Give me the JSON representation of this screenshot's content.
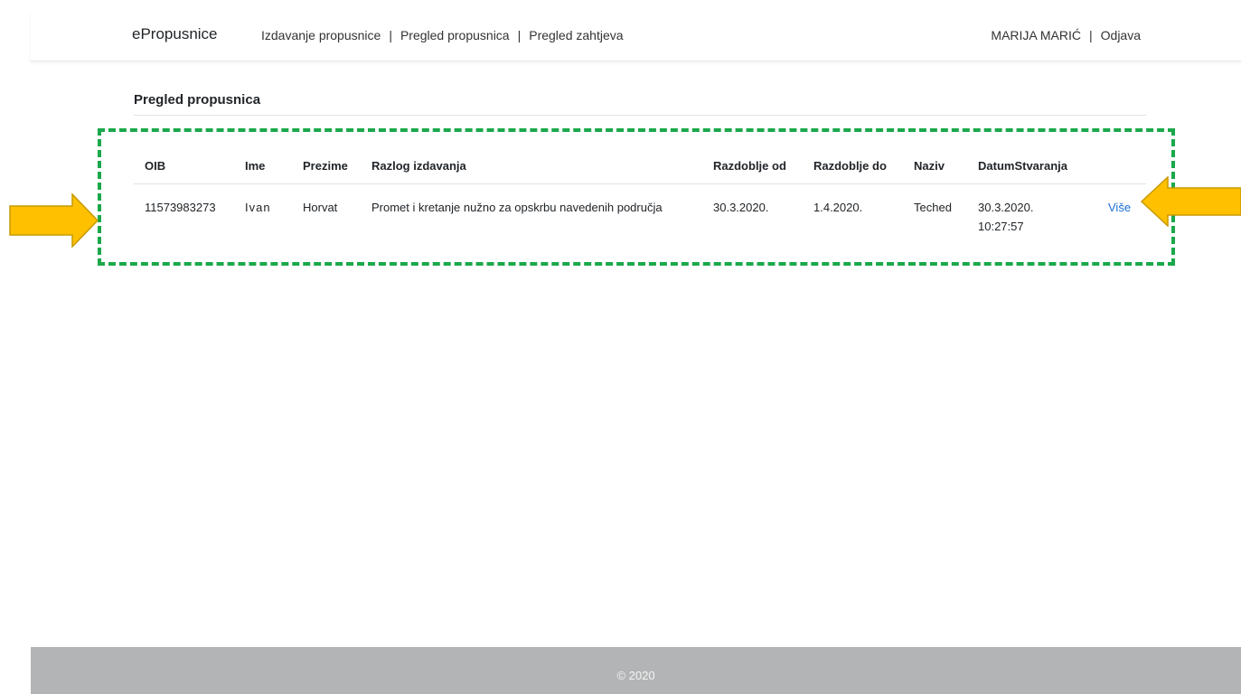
{
  "navbar": {
    "brand": "ePropusnice",
    "links": [
      "Izdavanje propusnice",
      "Pregled propusnica",
      "Pregled zahtjeva"
    ],
    "separator": "|",
    "user_name": "MARIJA MARIĆ",
    "logout": "Odjava"
  },
  "page": {
    "title": "Pregled propusnica"
  },
  "table": {
    "headers": [
      "OIB",
      "Ime",
      "Prezime",
      "Razlog izdavanja",
      "Razdoblje od",
      "Razdoblje do",
      "Naziv",
      "DatumStvaranja",
      ""
    ],
    "rows": [
      {
        "oib": "11573983273",
        "ime": "Ivan",
        "prezime": "Horvat",
        "razlog": "Promet i kretanje nužno za opskrbu navedenih područja",
        "od": "30.3.2020.",
        "do": "1.4.2020.",
        "naziv": "Teched",
        "datum": "30.3.2020. 10:27:57",
        "more": "Više"
      }
    ]
  },
  "footer": {
    "text": "© 2020"
  },
  "colors": {
    "highlight": "#1aa84b",
    "arrow_fill": "#ffc000",
    "arrow_stroke": "#c79a00",
    "link": "#1a6fd6",
    "footer_bg": "#b3b4b5"
  }
}
